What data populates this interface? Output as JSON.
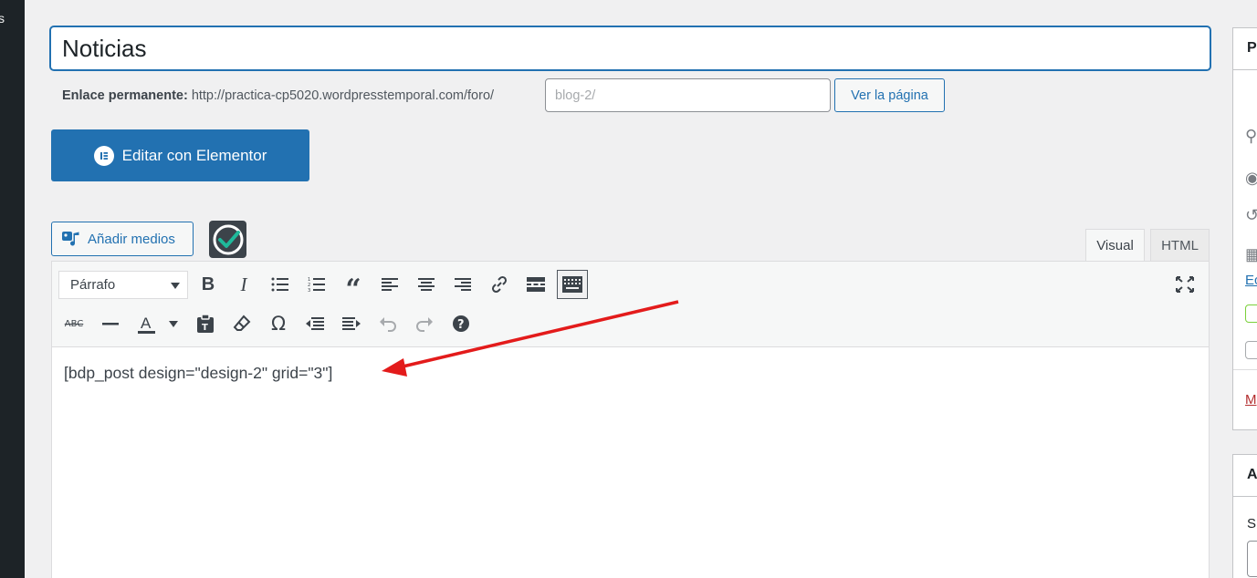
{
  "sidebar": {
    "partial_text": "s"
  },
  "post": {
    "title": "Noticias"
  },
  "permalink": {
    "label": "Enlace permanente:",
    "base_url": "http://practica-cp5020.wordpresstemporal.com/foro/",
    "slug_placeholder": "blog-2/",
    "view_button": "Ver la página"
  },
  "elementor": {
    "button_label": "Editar con Elementor"
  },
  "media": {
    "add_media_label": "Añadir medios"
  },
  "editor": {
    "tabs": [
      {
        "label": "Visual"
      },
      {
        "label": "HTML"
      }
    ],
    "format_select": "Párrafo",
    "content": "[bdp_post design=\"design-2\" grid=\"3\"]",
    "annotation_arrow_color": "#e31b1b"
  },
  "side_panels": {
    "panel1_header": "P",
    "panel1_link": "Ec",
    "panel1_trash": "M",
    "panel2_header": "A",
    "panel2_sub": "Sı"
  },
  "colors": {
    "accent": "#2271b1",
    "admin_bar": "#1d2327"
  }
}
